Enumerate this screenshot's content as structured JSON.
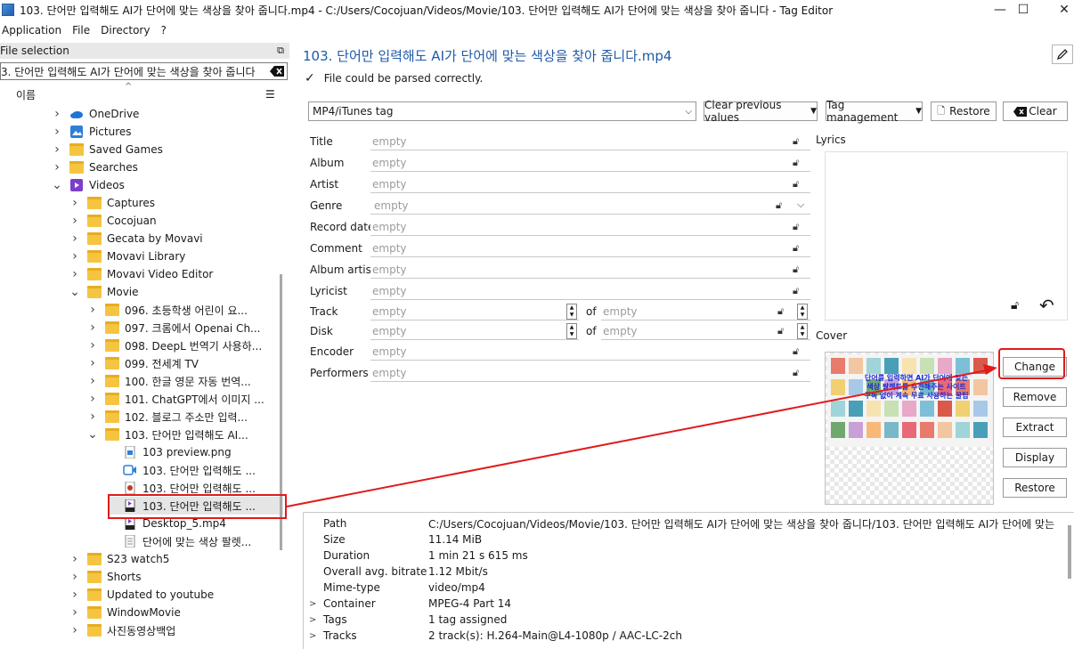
{
  "window": {
    "title": "103. 단어만 입력해도 AI가 단어에 맞는 색상을 찾아 줍니다.mp4 - C:/Users/Cocojuan/Videos/Movie/103. 단어만 입력해도 AI가 단어에 맞는 색상을 찾아 줍니다 - Tag Editor",
    "minimize": "—",
    "maximize": "☐",
    "close": "✕"
  },
  "menu": [
    "Application",
    "File",
    "Directory",
    "?"
  ],
  "left": {
    "header": "File selection",
    "path": "3. 단어만 입력해도 AI가 단어에 맞는 색상을 찾아 줍니다",
    "column_name": "이름",
    "tree": [
      {
        "label": "OneDrive",
        "level": 1,
        "icon": "cloud-icon",
        "chev": ">"
      },
      {
        "label": "Pictures",
        "level": 1,
        "icon": "pictures-icon",
        "chev": ">"
      },
      {
        "label": "Saved Games",
        "level": 1,
        "icon": "folder-icon",
        "chev": ">"
      },
      {
        "label": "Searches",
        "level": 1,
        "icon": "folder-icon",
        "chev": ">"
      },
      {
        "label": "Videos",
        "level": 1,
        "icon": "videos-icon",
        "chev": "v"
      },
      {
        "label": "Captures",
        "level": 2,
        "icon": "folder-icon",
        "chev": ">"
      },
      {
        "label": "Cocojuan",
        "level": 2,
        "icon": "folder-icon",
        "chev": ">"
      },
      {
        "label": "Gecata by Movavi",
        "level": 2,
        "icon": "folder-icon",
        "chev": ">"
      },
      {
        "label": "Movavi Library",
        "level": 2,
        "icon": "folder-icon",
        "chev": ">"
      },
      {
        "label": "Movavi Video Editor",
        "level": 2,
        "icon": "folder-icon",
        "chev": ">"
      },
      {
        "label": "Movie",
        "level": 2,
        "icon": "folder-icon",
        "chev": "v"
      },
      {
        "label": "096. 초등학생 어린이 요...",
        "level": 3,
        "icon": "folder-icon",
        "chev": ">"
      },
      {
        "label": "097. 크롬에서 Openai Ch...",
        "level": 3,
        "icon": "folder-icon",
        "chev": ">"
      },
      {
        "label": "098. DeepL 번역기 사용하...",
        "level": 3,
        "icon": "folder-icon",
        "chev": ">"
      },
      {
        "label": "099. 전세계 TV",
        "level": 3,
        "icon": "folder-icon",
        "chev": ">"
      },
      {
        "label": "100. 한글 영문 자동 번역...",
        "level": 3,
        "icon": "folder-icon",
        "chev": ">"
      },
      {
        "label": "101. ChatGPT에서 이미지 ...",
        "level": 3,
        "icon": "folder-icon",
        "chev": ">"
      },
      {
        "label": "102. 블로그 주소만 입력...",
        "level": 3,
        "icon": "folder-icon",
        "chev": ">"
      },
      {
        "label": "103. 단어만 입력해도 AI...",
        "level": 3,
        "icon": "folder-icon",
        "chev": "v"
      },
      {
        "label": "103 preview.png",
        "level": 4,
        "icon": "image-file-icon",
        "chev": ""
      },
      {
        "label": "103. 단어만 입력해도 ...",
        "level": 4,
        "icon": "video-file-icon",
        "chev": ""
      },
      {
        "label": "103. 단어만 입력해도 ...",
        "level": 4,
        "icon": "media-file-icon",
        "chev": ""
      },
      {
        "label": "103. 단어만 입력해도 ...",
        "level": 4,
        "icon": "mp4-file-icon",
        "chev": "",
        "selected": true
      },
      {
        "label": "Desktop_5.mp4",
        "level": 4,
        "icon": "mp4-file-icon",
        "chev": ""
      },
      {
        "label": "단어에 맞는 색상 팔렛...",
        "level": 4,
        "icon": "text-file-icon",
        "chev": ""
      },
      {
        "label": "S23 watch5",
        "level": 2,
        "icon": "folder-icon",
        "chev": ">"
      },
      {
        "label": "Shorts",
        "level": 2,
        "icon": "folder-icon",
        "chev": ">"
      },
      {
        "label": "Updated to youtube",
        "level": 2,
        "icon": "folder-icon",
        "chev": ">"
      },
      {
        "label": "WindowMovie",
        "level": 2,
        "icon": "folder-icon",
        "chev": ">"
      },
      {
        "label": "사진동영상백업",
        "level": 2,
        "icon": "folder-icon",
        "chev": ">"
      }
    ]
  },
  "main": {
    "file_title": "103. 단어만 입력해도 AI가 단어에 맞는 색상을 찾아 줍니다.mp4",
    "parse_message": "File could be parsed correctly.",
    "tag_type": "MP4/iTunes tag",
    "clear_previous": "Clear previous values",
    "tag_management": "Tag management",
    "restore": "Restore",
    "clear": "Clear",
    "empty": "empty",
    "of": "of",
    "fields": {
      "title": "Title",
      "album": "Album",
      "artist": "Artist",
      "genre": "Genre",
      "record_date": "Record date",
      "comment": "Comment",
      "album_artist": "Album artist",
      "lyricist": "Lyricist",
      "track": "Track",
      "disk": "Disk",
      "encoder": "Encoder",
      "performers": "Performers"
    },
    "lyrics_label": "Lyrics",
    "cover_label": "Cover",
    "cover_caption": "단어를 입력하면 AI가 단어에 맞는 색상 팔렛트를 추천해주는 사이트 구독 없이 계속 무료 사용하는 꿀팁",
    "cover_buttons": {
      "change": "Change",
      "remove": "Remove",
      "extract": "Extract",
      "display": "Display",
      "restore": "Restore"
    },
    "colors": {
      "title_blue": "#1e5aa8",
      "highlight_red": "#e01b1b"
    }
  },
  "properties": [
    {
      "key": "Path",
      "value": "C:/Users/Cocojuan/Videos/Movie/103. 단어만 입력해도 AI가 단어에 맞는 색상을 찾아 줍니다/103. 단어만 입력해도 AI가 단어에 맞는",
      "expand": ""
    },
    {
      "key": "Size",
      "value": "11.14 MiB",
      "expand": ""
    },
    {
      "key": "Duration",
      "value": "1 min 21 s 615 ms",
      "expand": ""
    },
    {
      "key": "Overall avg. bitrate",
      "value": "1.12 Mbit/s",
      "expand": ""
    },
    {
      "key": "Mime-type",
      "value": "video/mp4",
      "expand": ""
    },
    {
      "key": "Container",
      "value": "MPEG-4 Part 14",
      "expand": ">"
    },
    {
      "key": "Tags",
      "value": "1 tag assigned",
      "expand": ">"
    },
    {
      "key": "Tracks",
      "value": "2 track(s): H.264-Main@L4-1080p / AAC-LC-2ch",
      "expand": ">"
    }
  ]
}
